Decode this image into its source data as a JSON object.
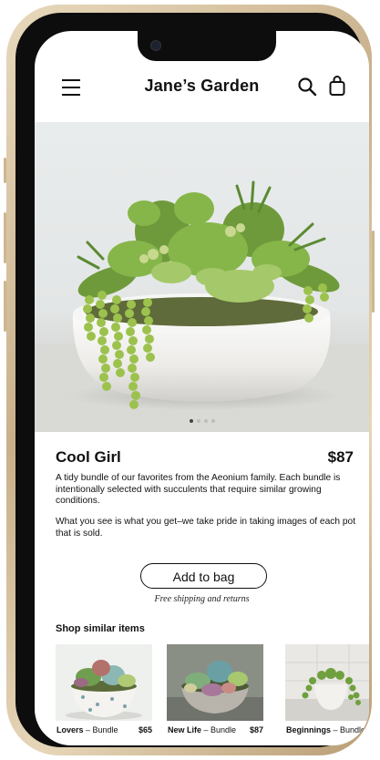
{
  "header": {
    "title": "Jane’s Garden"
  },
  "hero": {
    "slide_count": 4,
    "active_slide": 1
  },
  "product": {
    "name": "Cool Girl",
    "price": "$87",
    "description_1": "A tidy bundle of our favorites from the Aeonium family. Each bundle is intentionally selected with succulents that require similar growing conditions.",
    "description_2": "What you see is what you get–we take pride in taking images of each pot that is sold."
  },
  "actions": {
    "add_to_bag": "Add to bag",
    "shipping_note": "Free shipping and returns"
  },
  "similar": {
    "title": "Shop similar items",
    "items": [
      {
        "name": "Lovers",
        "type": " – Bundle",
        "price": "$65"
      },
      {
        "name": "New Life",
        "type": " – Bundle",
        "price": "$87"
      },
      {
        "name": "Beginnings",
        "type": " – Bundle",
        "price": ""
      }
    ]
  },
  "colors": {
    "text": "#111111",
    "frame_gold": "#c8b08a",
    "plant_green": "#8fbf4a",
    "pot_white": "#f2f2f0"
  }
}
